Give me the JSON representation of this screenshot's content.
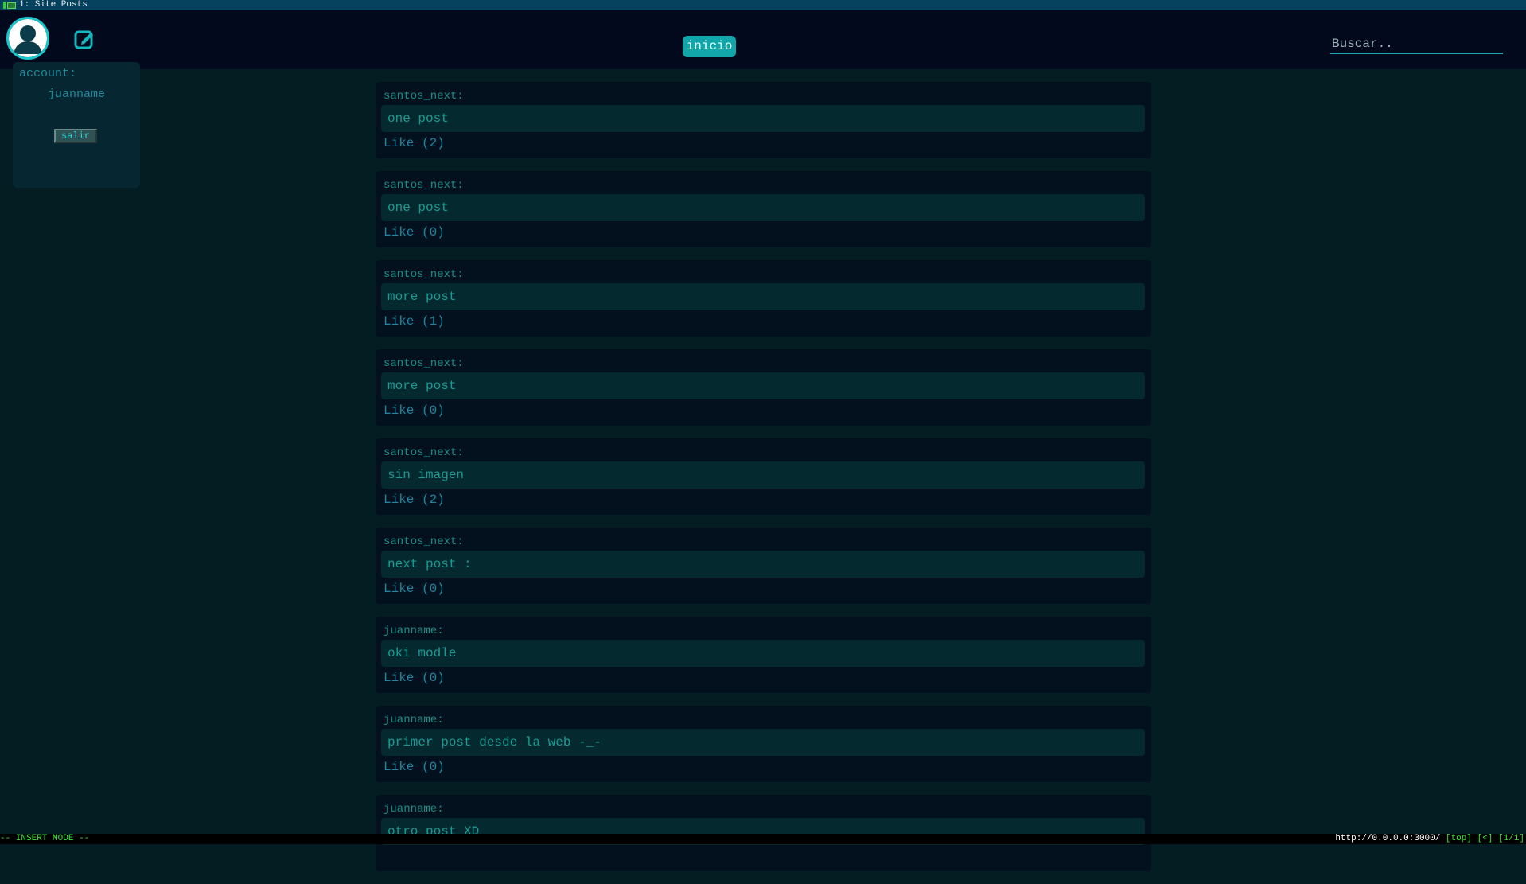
{
  "tabbar": {
    "title": "1: Site Posts"
  },
  "header": {
    "inicio_label": "inicio",
    "search_placeholder": "Buscar.."
  },
  "account": {
    "label": "account:",
    "username": "juanname",
    "logout_label": "salir"
  },
  "posts": [
    {
      "author": "santos_next:",
      "body": "one post",
      "like": "Like (2)"
    },
    {
      "author": "santos_next:",
      "body": "one post",
      "like": "Like (0)"
    },
    {
      "author": "santos_next:",
      "body": "more post",
      "like": "Like (1)"
    },
    {
      "author": "santos_next:",
      "body": "more post",
      "like": "Like (0)"
    },
    {
      "author": "santos_next:",
      "body": "sin imagen",
      "like": "Like (2)"
    },
    {
      "author": "santos_next:",
      "body": "next post :",
      "like": "Like (0)"
    },
    {
      "author": "juanname:",
      "body": "oki modle",
      "like": "Like (0)"
    },
    {
      "author": "juanname:",
      "body": "primer post desde la web -_-",
      "like": "Like (0)"
    },
    {
      "author": "juanname:",
      "body": "otro post XD",
      "like": ""
    }
  ],
  "statusbar": {
    "mode": "-- INSERT MODE --",
    "url": "http://0.0.0.0:3000/",
    "position": "[top] [<] [1/1]"
  },
  "colors": {
    "accent": "#12a6aa",
    "background": "#041d22",
    "header_bg": "#03091c"
  },
  "icons": {
    "avatar": "user-avatar-icon",
    "compose": "edit-square-icon"
  }
}
